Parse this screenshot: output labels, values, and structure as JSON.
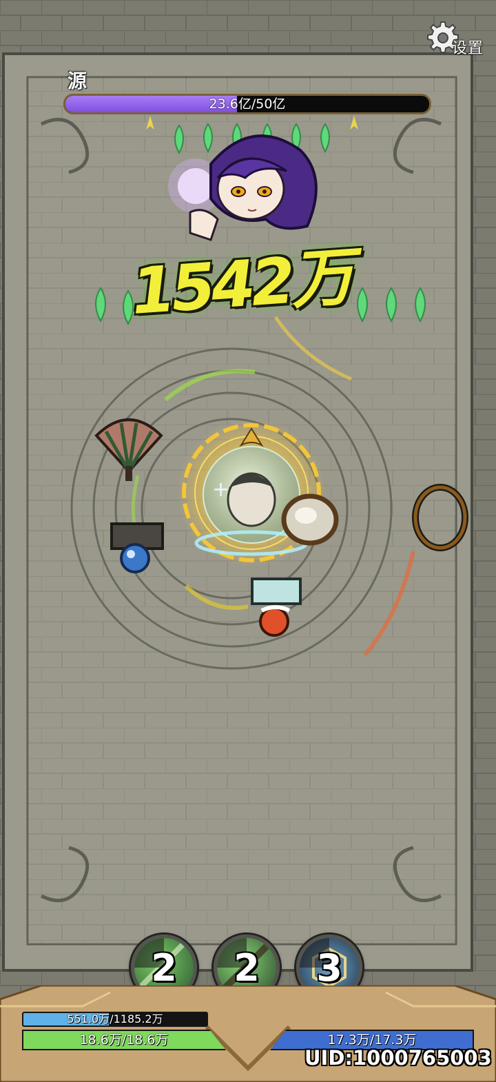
{
  "settings": {
    "label": "设置",
    "icon": "gear-icon"
  },
  "boss": {
    "name": "源",
    "hp_text": "23.6亿/50亿",
    "hp_fraction": 0.472,
    "hp_color": "#9a6cf0"
  },
  "combat": {
    "damage_text": "1542万"
  },
  "skills": [
    {
      "count": "2",
      "icon": "green-slash-skill-icon"
    },
    {
      "count": "2",
      "icon": "dark-slash-skill-icon"
    },
    {
      "count": "3",
      "icon": "hex-shield-skill-icon"
    }
  ],
  "player": {
    "exp_text": "551.0万/1185.2万",
    "exp_fraction": 0.465,
    "hp_text": "18.6万/18.6万",
    "hp_fraction": 1.0,
    "mp_text": "17.3万/17.3万",
    "mp_fraction": 1.0,
    "uid": "UID:1000765003"
  },
  "colors": {
    "exp": "#5fb2e8",
    "hp": "#7fd95c",
    "mp": "#3f6ed0"
  }
}
